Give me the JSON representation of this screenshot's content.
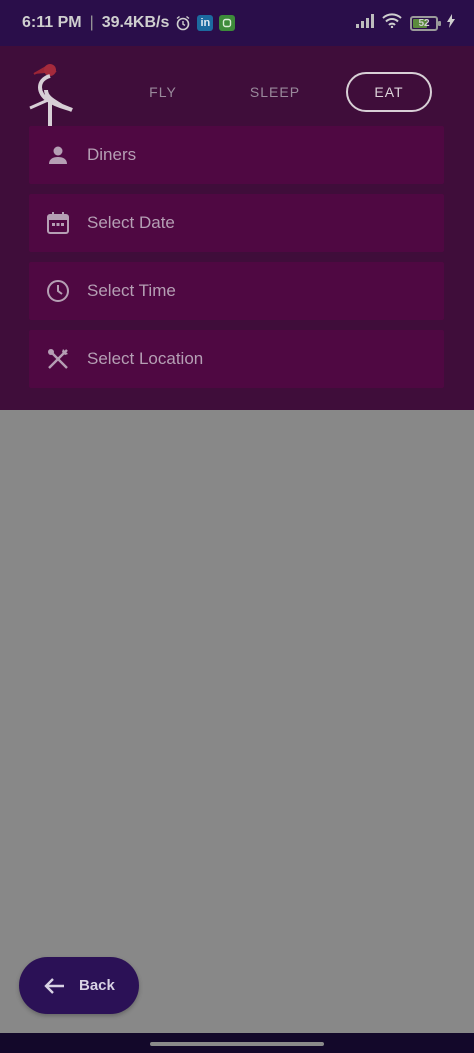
{
  "status_bar": {
    "time": "6:11 PM",
    "separator": "|",
    "network_speed": "39.4KB/s",
    "linkedin_badge": "in",
    "battery_level": "52",
    "icons": [
      "alarm-icon",
      "linkedin-icon",
      "app-notification-icon",
      "signal-icon",
      "wifi-icon",
      "battery-icon",
      "charging-icon"
    ]
  },
  "header": {
    "logo_icon": "heron-logo-icon",
    "tabs": [
      {
        "label": "FLY",
        "active": false
      },
      {
        "label": "SLEEP",
        "active": false
      },
      {
        "label": "EAT",
        "active": true
      }
    ]
  },
  "form": {
    "fields": [
      {
        "placeholder": "Diners",
        "icon": "person-icon"
      },
      {
        "placeholder": "Select Date",
        "icon": "calendar-icon"
      },
      {
        "placeholder": "Select Time",
        "icon": "clock-icon"
      },
      {
        "placeholder": "Select Location",
        "icon": "fork-knife-icon"
      }
    ]
  },
  "back_button": {
    "label": "Back",
    "icon": "arrow-left-icon"
  },
  "colors": {
    "status_bar_bg": "#2a0e4a",
    "panel_bg": "#3f0d3a",
    "field_bg": "#4f0842",
    "overlay_bg": "#888888",
    "back_button_bg": "#2b1156"
  }
}
